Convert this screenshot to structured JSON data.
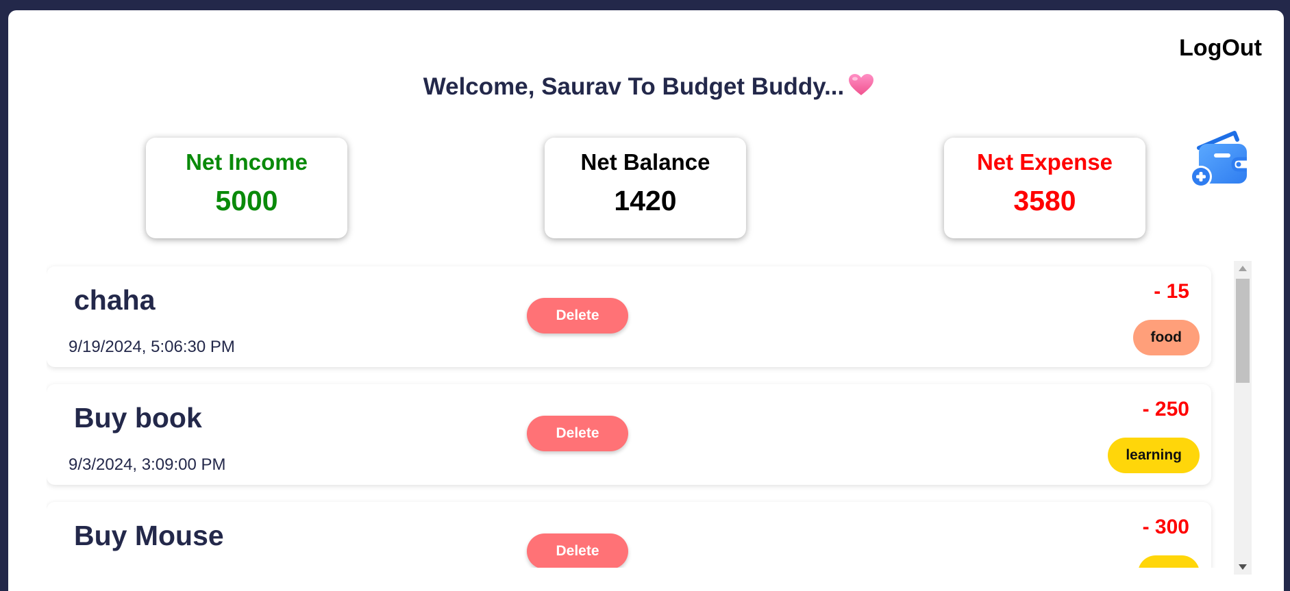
{
  "header": {
    "logout_label": "LogOut",
    "welcome_text": "Welcome, Saurav To Budget Buddy..."
  },
  "stats": {
    "income": {
      "label": "Net Income",
      "value": "5000"
    },
    "balance": {
      "label": "Net Balance",
      "value": "1420"
    },
    "expense": {
      "label": "Net Expense",
      "value": "3580"
    }
  },
  "transactions": [
    {
      "title": "chaha",
      "date": "9/19/2024, 5:06:30 PM",
      "amount": "- 15",
      "category": "food",
      "category_color": "#ff9f7a",
      "delete_label": "Delete"
    },
    {
      "title": "Buy book",
      "date": "9/3/2024, 3:09:00 PM",
      "amount": "- 250",
      "category": "learning",
      "category_color": "#ffd60a",
      "delete_label": "Delete"
    },
    {
      "title": "Buy Mouse",
      "date": "",
      "amount": "- 300",
      "category": "",
      "category_color": "#ffd60a",
      "delete_label": "Delete"
    }
  ],
  "icons": {
    "heart": "pink-heart-icon",
    "wallet": "add-wallet-icon"
  },
  "colors": {
    "page_bg": "#23284a",
    "income": "#0a8a0a",
    "expense": "#ff0000",
    "delete_button": "#ff7276"
  }
}
